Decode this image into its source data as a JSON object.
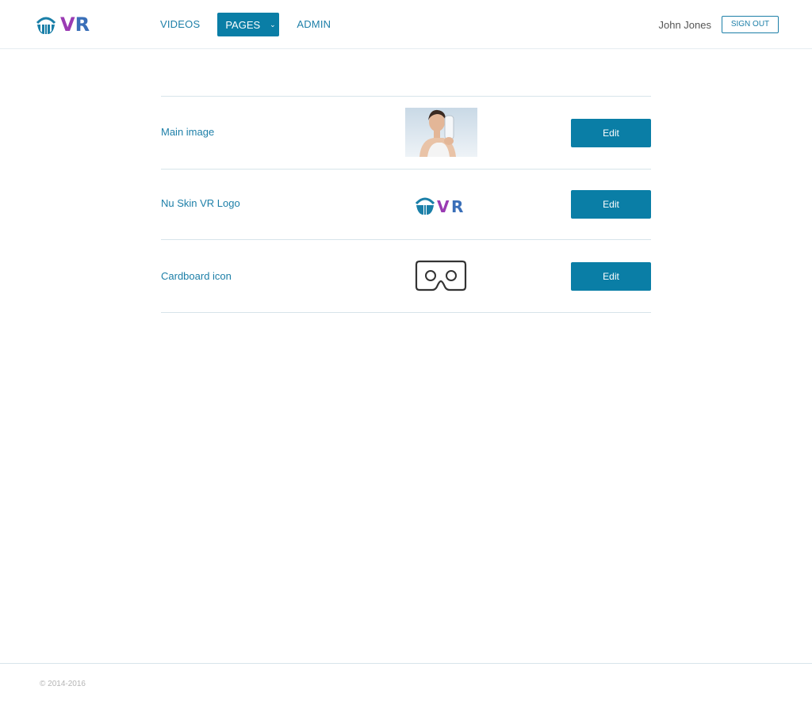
{
  "header": {
    "logo": {
      "text_v": "V",
      "text_r": "R",
      "icon": "nuskin-logo-icon"
    },
    "nav": {
      "videos": "VIDEOS",
      "pages": "PAGES",
      "pages_chevron": "chevron-down-icon",
      "admin": "ADMIN"
    },
    "user_name": "John Jones",
    "sign_out": "SIGN OUT"
  },
  "rows": [
    {
      "label": "Main image",
      "thumbnail": "woman-holding-product-image",
      "button": "Edit"
    },
    {
      "label": "Nu Skin VR Logo",
      "thumbnail": "nuskin-vr-logo-image",
      "button": "Edit"
    },
    {
      "label": "Cardboard icon",
      "thumbnail": "cardboard-viewer-icon",
      "button": "Edit"
    }
  ],
  "footer": {
    "copyright": "© 2014-2016"
  },
  "colors": {
    "accent": "#0a7ea6",
    "link": "#1d7fa8",
    "logo_v": "#9a3bb3",
    "logo_r": "#3a6fb8",
    "divider": "#d7e4ea"
  }
}
